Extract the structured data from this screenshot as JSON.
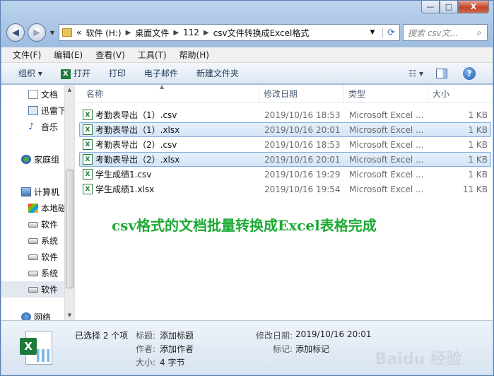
{
  "window": {
    "controls": {
      "minimize": "—",
      "maximize": "□",
      "close": "X"
    }
  },
  "address": {
    "crumbs": [
      "«",
      "软件 (H:)",
      "桌面文件",
      "112",
      "csv文件转换成Excel格式"
    ],
    "search_placeholder": "搜索 csv文..."
  },
  "menubar": [
    "文件(F)",
    "编辑(E)",
    "查看(V)",
    "工具(T)",
    "帮助(H)"
  ],
  "toolbar": {
    "organize": "组织 ▾",
    "open": "打开",
    "print": "打印",
    "email": "电子邮件",
    "new_folder": "新建文件夹"
  },
  "nav": {
    "items": [
      {
        "label": "文档",
        "icon": "document-icon"
      },
      {
        "label": "迅雷下载",
        "icon": "thunder-icon"
      },
      {
        "label": "音乐",
        "icon": "music-icon"
      },
      {
        "label": "",
        "icon": ""
      },
      {
        "label": "家庭组",
        "icon": "homegroup-icon"
      },
      {
        "label": "",
        "icon": ""
      },
      {
        "label": "计算机",
        "icon": "computer-icon"
      },
      {
        "label": "本地磁盘",
        "icon": "system-disk-icon"
      },
      {
        "label": "软件",
        "icon": "disk-icon"
      },
      {
        "label": "系统",
        "icon": "disk-icon"
      },
      {
        "label": "软件",
        "icon": "disk-icon"
      },
      {
        "label": "系统",
        "icon": "disk-icon"
      },
      {
        "label": "软件",
        "icon": "disk-icon"
      },
      {
        "label": "",
        "icon": ""
      },
      {
        "label": "网络",
        "icon": "network-icon"
      }
    ]
  },
  "columns": {
    "name": "名称",
    "date": "修改日期",
    "type": "类型",
    "size": "大小"
  },
  "files": [
    {
      "name": "考勤表导出（1）.csv",
      "date": "2019/10/16 18:53",
      "type": "Microsoft Excel ...",
      "size": "1 KB",
      "selected": false
    },
    {
      "name": "考勤表导出（1）.xlsx",
      "date": "2019/10/16 20:01",
      "type": "Microsoft Excel ...",
      "size": "1 KB",
      "selected": true
    },
    {
      "name": "考勤表导出（2）.csv",
      "date": "2019/10/16 18:53",
      "type": "Microsoft Excel ...",
      "size": "1 KB",
      "selected": false
    },
    {
      "name": "考勤表导出（2）.xlsx",
      "date": "2019/10/16 20:01",
      "type": "Microsoft Excel ...",
      "size": "1 KB",
      "selected": true
    },
    {
      "name": "学生成绩1.csv",
      "date": "2019/10/16 19:29",
      "type": "Microsoft Excel ...",
      "size": "1 KB",
      "selected": false
    },
    {
      "name": "学生成绩1.xlsx",
      "date": "2019/10/16 19:54",
      "type": "Microsoft Excel ...",
      "size": "11 KB",
      "selected": false
    }
  ],
  "annotation": "csv格式的文档批量转换成Excel表格完成",
  "details": {
    "selected": "已选择 2 个项",
    "title_label": "标题:",
    "title_value": "添加标题",
    "author_label": "作者:",
    "author_value": "添加作者",
    "size_label": "大小:",
    "size_value": "4 字节",
    "modified_label": "修改日期:",
    "modified_value": "2019/10/16 20:01",
    "tags_label": "标记:",
    "tags_value": "添加标记"
  },
  "watermark": "Baidu 经验"
}
